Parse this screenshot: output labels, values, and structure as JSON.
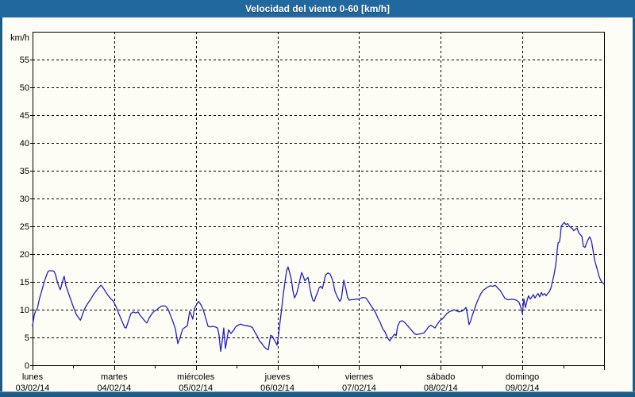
{
  "window": {
    "title": "Velocidad del viento 0-60 [km/h]"
  },
  "colors": {
    "titlebar_bg": "#21689F",
    "frame": "#1E5C88",
    "chart_bg": "#FDFDF6",
    "line": "#2121C1",
    "grid": "#000000",
    "title_text": "#FFFFFF"
  },
  "chart_data": {
    "type": "line",
    "title": "Velocidad del viento 0-60 [km/h]",
    "ylabel": "km/h",
    "xlabel": "",
    "ylim": [
      0,
      60
    ],
    "xlim": [
      0,
      168
    ],
    "x_unit": "hours since Monday 03/02/14 00:00",
    "grid": "dashed black, horizontal every 5 km/h, vertical at day boundaries",
    "legend": "none",
    "yticks": [
      0,
      5,
      10,
      15,
      20,
      25,
      30,
      35,
      40,
      45,
      50,
      55
    ],
    "days": [
      {
        "name": "lunes",
        "date": "03/02/14"
      },
      {
        "name": "martes",
        "date": "04/02/14"
      },
      {
        "name": "miércoles",
        "date": "05/02/14"
      },
      {
        "name": "jueves",
        "date": "06/02/14"
      },
      {
        "name": "viernes",
        "date": "07/02/14"
      },
      {
        "name": "sábado",
        "date": "08/02/14"
      },
      {
        "name": "domingo",
        "date": "09/02/14"
      }
    ],
    "series": [
      {
        "name": "Velocidad del viento",
        "color": "#2121C1",
        "points": [
          [
            0,
            7.1
          ],
          [
            0.5,
            9
          ],
          [
            0.9,
            9.8
          ],
          [
            1.4,
            10.2
          ],
          [
            2,
            11.9
          ],
          [
            2.8,
            13.6
          ],
          [
            3.6,
            15.3
          ],
          [
            4.4,
            16.7
          ],
          [
            4.8,
            17
          ],
          [
            5.8,
            17
          ],
          [
            6.3,
            16.9
          ],
          [
            6.7,
            16.4
          ],
          [
            7.5,
            14.6
          ],
          [
            7.9,
            13.9
          ],
          [
            8.2,
            13.6
          ],
          [
            9.1,
            15.7
          ],
          [
            9.3,
            16
          ],
          [
            9.8,
            14.3
          ],
          [
            10.6,
            12.9
          ],
          [
            11.4,
            11.5
          ],
          [
            12.1,
            10.3
          ],
          [
            12.9,
            9.1
          ],
          [
            13.7,
            8.4
          ],
          [
            14.1,
            8.1
          ],
          [
            14.9,
            9.5
          ],
          [
            15.2,
            10
          ],
          [
            16.1,
            11
          ],
          [
            17,
            11.8
          ],
          [
            18,
            12.8
          ],
          [
            19.1,
            13.7
          ],
          [
            20.1,
            14.4
          ],
          [
            20.8,
            13.9
          ],
          [
            21.5,
            13.2
          ],
          [
            22.4,
            12.4
          ],
          [
            23.1,
            11.9
          ],
          [
            23.8,
            11.5
          ],
          [
            24.5,
            10.6
          ],
          [
            25.4,
            9.2
          ],
          [
            26.4,
            7.8
          ],
          [
            27.1,
            6.8
          ],
          [
            27.5,
            6.7
          ],
          [
            28.2,
            8
          ],
          [
            28.9,
            9.3
          ],
          [
            29.6,
            9.6
          ],
          [
            30.3,
            9.4
          ],
          [
            31,
            9.6
          ],
          [
            31.7,
            8.9
          ],
          [
            32.4,
            8.4
          ],
          [
            33.1,
            7.9
          ],
          [
            33.6,
            7.6
          ],
          [
            34.3,
            8.5
          ],
          [
            35,
            9.2
          ],
          [
            35.7,
            9.7
          ],
          [
            36.4,
            9.9
          ],
          [
            37.1,
            10.3
          ],
          [
            37.8,
            10.6
          ],
          [
            38.5,
            10.7
          ],
          [
            39.2,
            10.6
          ],
          [
            39.9,
            10
          ],
          [
            40.6,
            8.9
          ],
          [
            41.3,
            7.8
          ],
          [
            42,
            6.5
          ],
          [
            42.7,
            3.9
          ],
          [
            43.4,
            5
          ],
          [
            44.1,
            6.5
          ],
          [
            44.8,
            6.8
          ],
          [
            45.5,
            7.1
          ],
          [
            46.2,
            9.7
          ],
          [
            46.7,
            9
          ],
          [
            47.1,
            8.3
          ],
          [
            47.6,
            10.2
          ],
          [
            48.3,
            11
          ],
          [
            48.8,
            11.5
          ],
          [
            49.5,
            10.9
          ],
          [
            50.2,
            10
          ],
          [
            50.9,
            8.5
          ],
          [
            51.6,
            7
          ],
          [
            52.3,
            6.9
          ],
          [
            53,
            7
          ],
          [
            53.7,
            6.9
          ],
          [
            54.4,
            6.7
          ],
          [
            54.8,
            5.5
          ],
          [
            55.3,
            2.5
          ],
          [
            55.8,
            4.5
          ],
          [
            56.2,
            6.7
          ],
          [
            56.7,
            3
          ],
          [
            57.2,
            4.8
          ],
          [
            57.6,
            6.4
          ],
          [
            58.3,
            5.7
          ],
          [
            59,
            6.2
          ],
          [
            59.7,
            6.9
          ],
          [
            60.4,
            7.2
          ],
          [
            61.1,
            7.4
          ],
          [
            62.1,
            7.2
          ],
          [
            63,
            7.1
          ],
          [
            63.9,
            7
          ],
          [
            64.6,
            6.8
          ],
          [
            65.3,
            6
          ],
          [
            66,
            5.3
          ],
          [
            66.7,
            4.4
          ],
          [
            67.4,
            3.9
          ],
          [
            68.1,
            3.3
          ],
          [
            68.8,
            2.9
          ],
          [
            69.3,
            2.8
          ],
          [
            70,
            5.4
          ],
          [
            70.5,
            5.2
          ],
          [
            70.9,
            4.7
          ],
          [
            71.4,
            4.2
          ],
          [
            71.9,
            3.6
          ],
          [
            72.3,
            5.5
          ],
          [
            72.8,
            8
          ],
          [
            73.3,
            10.5
          ],
          [
            73.7,
            12.8
          ],
          [
            74.2,
            15
          ],
          [
            74.7,
            17
          ],
          [
            75.1,
            17.7
          ],
          [
            75.6,
            16.6
          ],
          [
            76.1,
            15.4
          ],
          [
            76.5,
            13.5
          ],
          [
            77,
            12.1
          ],
          [
            77.7,
            13
          ],
          [
            78.4,
            14.8
          ],
          [
            79.1,
            16.7
          ],
          [
            79.6,
            16
          ],
          [
            80,
            15.2
          ],
          [
            80.5,
            15.5
          ],
          [
            81,
            15.8
          ],
          [
            81.4,
            14.3
          ],
          [
            81.9,
            12.8
          ],
          [
            82.4,
            11.7
          ],
          [
            82.8,
            11.5
          ],
          [
            83.3,
            12.4
          ],
          [
            83.8,
            13.1
          ],
          [
            84.2,
            13.9
          ],
          [
            84.7,
            14.2
          ],
          [
            85.2,
            13.8
          ],
          [
            85.6,
            14.8
          ],
          [
            86.1,
            16.2
          ],
          [
            86.8,
            16.6
          ],
          [
            87.5,
            16.4
          ],
          [
            88.2,
            15.3
          ],
          [
            88.9,
            13.3
          ],
          [
            89.6,
            12.3
          ],
          [
            90.3,
            11.5
          ],
          [
            90.8,
            12
          ],
          [
            91.5,
            15.3
          ],
          [
            92.2,
            13.5
          ],
          [
            92.6,
            12.2
          ],
          [
            93.1,
            11.7
          ],
          [
            93.8,
            11.8
          ],
          [
            94.5,
            11.8
          ],
          [
            95.2,
            11.9
          ],
          [
            95.9,
            11.9
          ],
          [
            96.6,
            12.1
          ],
          [
            97.3,
            12.2
          ],
          [
            98,
            12.1
          ],
          [
            98.7,
            11.5
          ],
          [
            99.4,
            10.8
          ],
          [
            100.1,
            10.2
          ],
          [
            100.8,
            9.5
          ],
          [
            101.5,
            8.5
          ],
          [
            102.2,
            7.7
          ],
          [
            102.9,
            6.6
          ],
          [
            103.6,
            6
          ],
          [
            104.3,
            5
          ],
          [
            105,
            4.4
          ],
          [
            105.7,
            5
          ],
          [
            106.4,
            5.6
          ],
          [
            106.9,
            5.3
          ],
          [
            107.3,
            7
          ],
          [
            108,
            7.9
          ],
          [
            108.7,
            8
          ],
          [
            109.4,
            7.7
          ],
          [
            110.1,
            7.2
          ],
          [
            110.8,
            6.7
          ],
          [
            111.5,
            6.2
          ],
          [
            112.2,
            5.7
          ],
          [
            112.9,
            5.5
          ],
          [
            113.6,
            5.6
          ],
          [
            114.3,
            5.7
          ],
          [
            115,
            5.8
          ],
          [
            115.7,
            6.3
          ],
          [
            116.4,
            6.9
          ],
          [
            117.1,
            7.2
          ],
          [
            117.6,
            7
          ],
          [
            118.3,
            6.7
          ],
          [
            119,
            7.4
          ],
          [
            119.7,
            8
          ],
          [
            120.4,
            8.3
          ],
          [
            121.1,
            8.8
          ],
          [
            121.8,
            9.3
          ],
          [
            122.5,
            9.6
          ],
          [
            123.2,
            9.8
          ],
          [
            123.9,
            10
          ],
          [
            124.6,
            9.8
          ],
          [
            125.3,
            9.6
          ],
          [
            126,
            9.7
          ],
          [
            126.7,
            9.9
          ],
          [
            127.4,
            10.4
          ],
          [
            127.9,
            9
          ],
          [
            128.3,
            7.3
          ],
          [
            128.8,
            8
          ],
          [
            129.3,
            9
          ],
          [
            130,
            10.2
          ],
          [
            130.4,
            11
          ],
          [
            131.1,
            12
          ],
          [
            131.8,
            12.9
          ],
          [
            132.5,
            13.5
          ],
          [
            133.2,
            13.8
          ],
          [
            133.9,
            14.1
          ],
          [
            134.6,
            14.3
          ],
          [
            135.3,
            14.2
          ],
          [
            136,
            14.4
          ],
          [
            136.7,
            13.9
          ],
          [
            137.4,
            13.5
          ],
          [
            138.1,
            12.8
          ],
          [
            138.8,
            12.1
          ],
          [
            139.5,
            11.8
          ],
          [
            140.2,
            11.8
          ],
          [
            140.9,
            11.9
          ],
          [
            141.6,
            11.8
          ],
          [
            142.3,
            11.7
          ],
          [
            143,
            11.3
          ],
          [
            143.5,
            10.5
          ],
          [
            144,
            9.3
          ],
          [
            144.4,
            11.9
          ],
          [
            144.9,
            10.4
          ],
          [
            145.4,
            11.7
          ],
          [
            145.8,
            12.5
          ],
          [
            146.3,
            11.9
          ],
          [
            146.8,
            12.3
          ],
          [
            147.2,
            12.7
          ],
          [
            147.7,
            12.1
          ],
          [
            148.2,
            12.6
          ],
          [
            148.6,
            12.9
          ],
          [
            149.1,
            12.3
          ],
          [
            149.6,
            13.1
          ],
          [
            150,
            12.6
          ],
          [
            150.5,
            12.9
          ],
          [
            151,
            12.5
          ],
          [
            151.4,
            12.9
          ],
          [
            151.9,
            13.2
          ],
          [
            152.4,
            13.9
          ],
          [
            152.8,
            15
          ],
          [
            153.3,
            16.3
          ],
          [
            153.8,
            18
          ],
          [
            154.2,
            20.5
          ],
          [
            154.5,
            22
          ],
          [
            154.9,
            22.2
          ],
          [
            155.2,
            23.4
          ],
          [
            155.4,
            25
          ],
          [
            155.9,
            25.4
          ],
          [
            156.3,
            25.7
          ],
          [
            156.8,
            25.3
          ],
          [
            157.3,
            25.5
          ],
          [
            157.7,
            25.1
          ],
          [
            158.2,
            24.8
          ],
          [
            158.7,
            24.6
          ],
          [
            159.1,
            24.2
          ],
          [
            159.6,
            24.5
          ],
          [
            160.1,
            24.7
          ],
          [
            160.5,
            23.9
          ],
          [
            161,
            23.5
          ],
          [
            161.5,
            23.2
          ],
          [
            161.9,
            21.4
          ],
          [
            162.4,
            21.2
          ],
          [
            162.9,
            22
          ],
          [
            163.3,
            22.6
          ],
          [
            163.8,
            23.1
          ],
          [
            164.3,
            22.4
          ],
          [
            164.7,
            20.9
          ],
          [
            165.2,
            19
          ],
          [
            165.7,
            17.9
          ],
          [
            166.1,
            17
          ],
          [
            166.6,
            15.9
          ],
          [
            167.1,
            15.2
          ],
          [
            167.5,
            14.9
          ],
          [
            168,
            14.6
          ]
        ]
      }
    ]
  }
}
